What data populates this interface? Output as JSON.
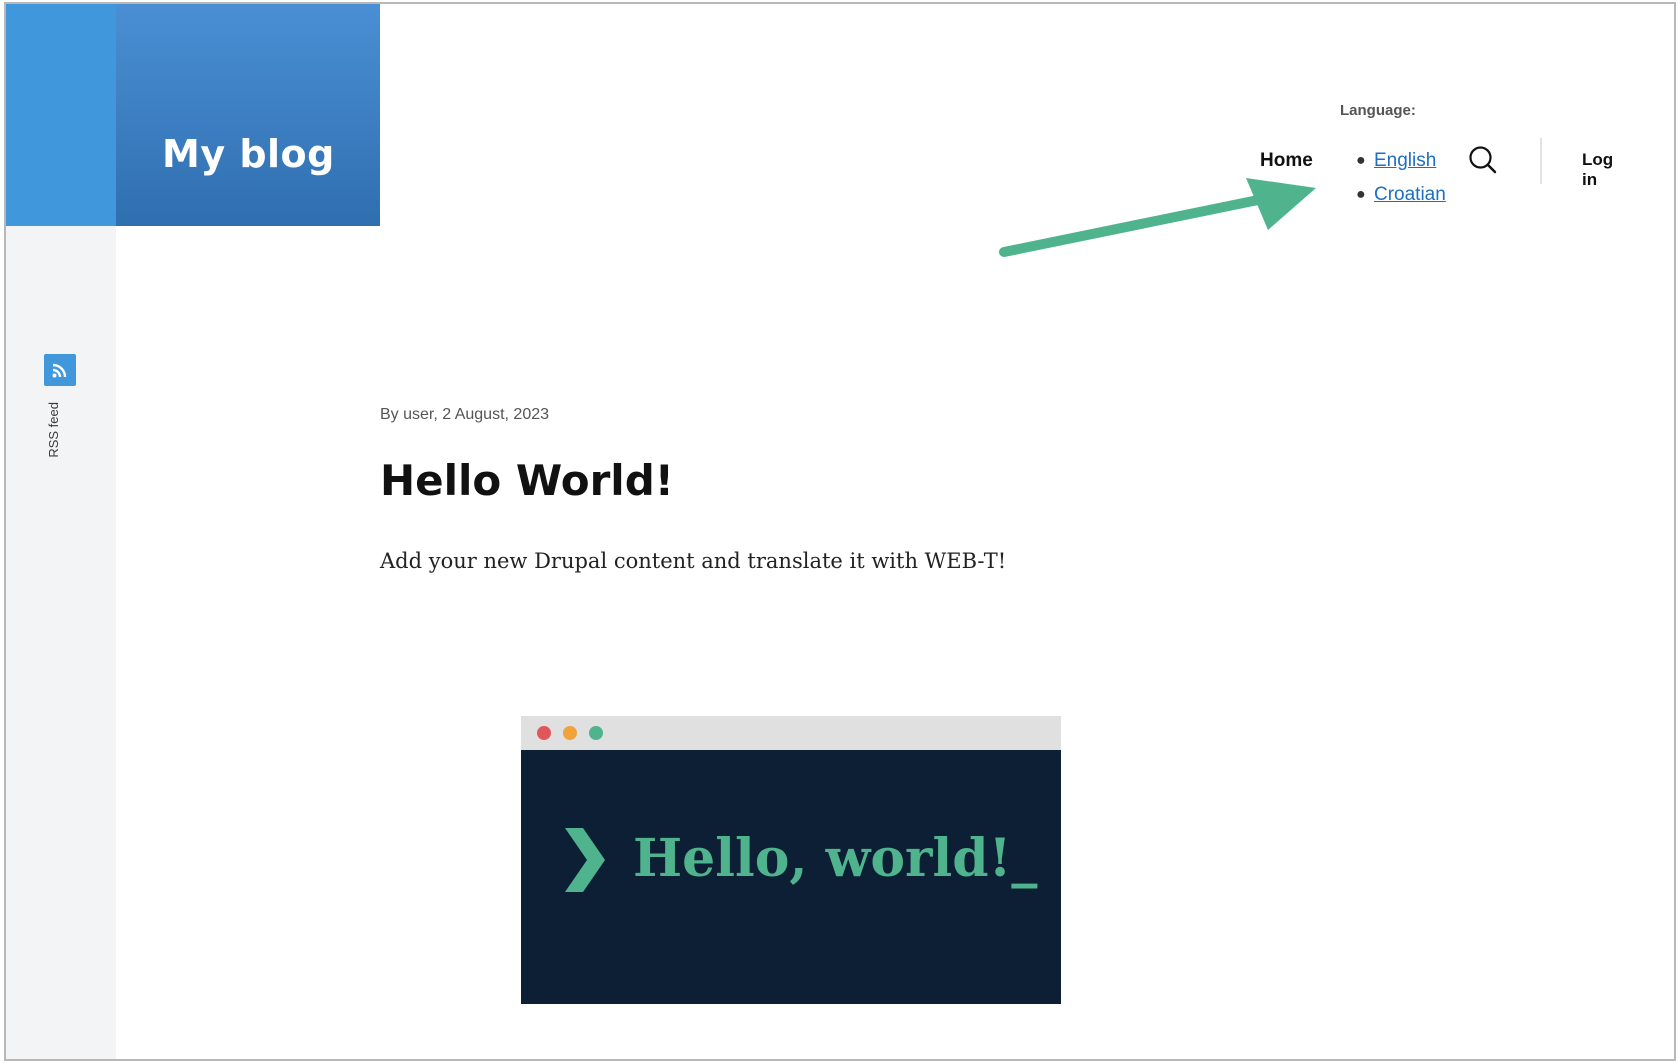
{
  "site": {
    "name": "My blog"
  },
  "sidebar": {
    "rss_label": "RSS feed",
    "rss_icon": "rss-icon"
  },
  "header": {
    "language_heading": "Language:",
    "home_label": "Home",
    "languages": [
      {
        "label": "English"
      },
      {
        "label": "Croatian"
      }
    ],
    "search_icon": "search-icon",
    "login_label": "Log in"
  },
  "article": {
    "meta": "By user, 2 August, 2023",
    "title": "Hello World!",
    "body": "Add your new Drupal content and translate it with WEB-T!",
    "image": {
      "text": "Hello, world!_",
      "prompt_icon": "chevron-right-icon",
      "window_dots": [
        "#e15759",
        "#f0a23b",
        "#4fb48d"
      ]
    }
  },
  "annotation": {
    "arrow_color": "#4fb48d"
  },
  "colors": {
    "brand": "#4197dc",
    "logo_gradient": [
      "#4a8fd4",
      "#2f6fb0"
    ],
    "link": "#1d6fc4",
    "image_bg": "#0d1f35"
  }
}
